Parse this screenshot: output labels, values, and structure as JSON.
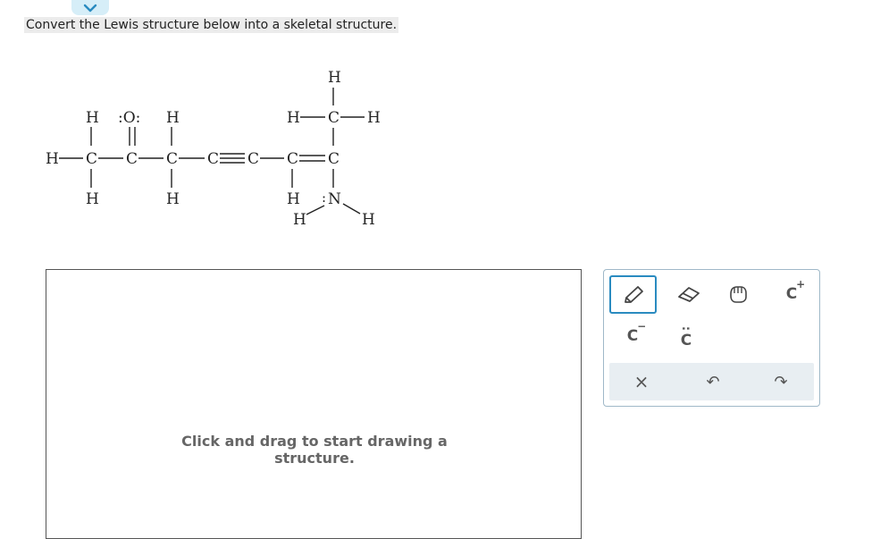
{
  "prompt": "Convert the Lewis structure below into a skeletal structure.",
  "lewis": {
    "atoms": {
      "h_top_left": "H",
      "o_top": ":O:",
      "h_top_mid": "H",
      "h_top_right": "H",
      "h_ch3_left": "H",
      "h_ch3_right": "H",
      "h_chain_left": "H",
      "c1": "C",
      "c2": "C",
      "c3": "C",
      "c4": "C",
      "c5": "C",
      "c6": "C",
      "c7": "C",
      "c8": "C",
      "h_bot_c1": "H",
      "h_bot_c3": "H",
      "h_bot_c6": "H",
      "n": "N",
      "n_lone": ":",
      "h_n_left": "H",
      "h_n_right": "H"
    }
  },
  "canvas": {
    "hint": "Click and drag to start drawing a structure."
  },
  "toolbox": {
    "tools": {
      "pencil": "pencil-icon",
      "eraser": "eraser-icon",
      "hand": "hand-icon",
      "cation": "C",
      "anion": "C",
      "lone_pair": "C"
    },
    "charges": {
      "cation": "+",
      "anion": "−",
      "lone_pair": ":"
    },
    "actions": {
      "clear": "×",
      "undo": "↶",
      "redo": "↷"
    }
  },
  "colors": {
    "accent": "#2a8bc0",
    "tab": "#d6eef8"
  }
}
